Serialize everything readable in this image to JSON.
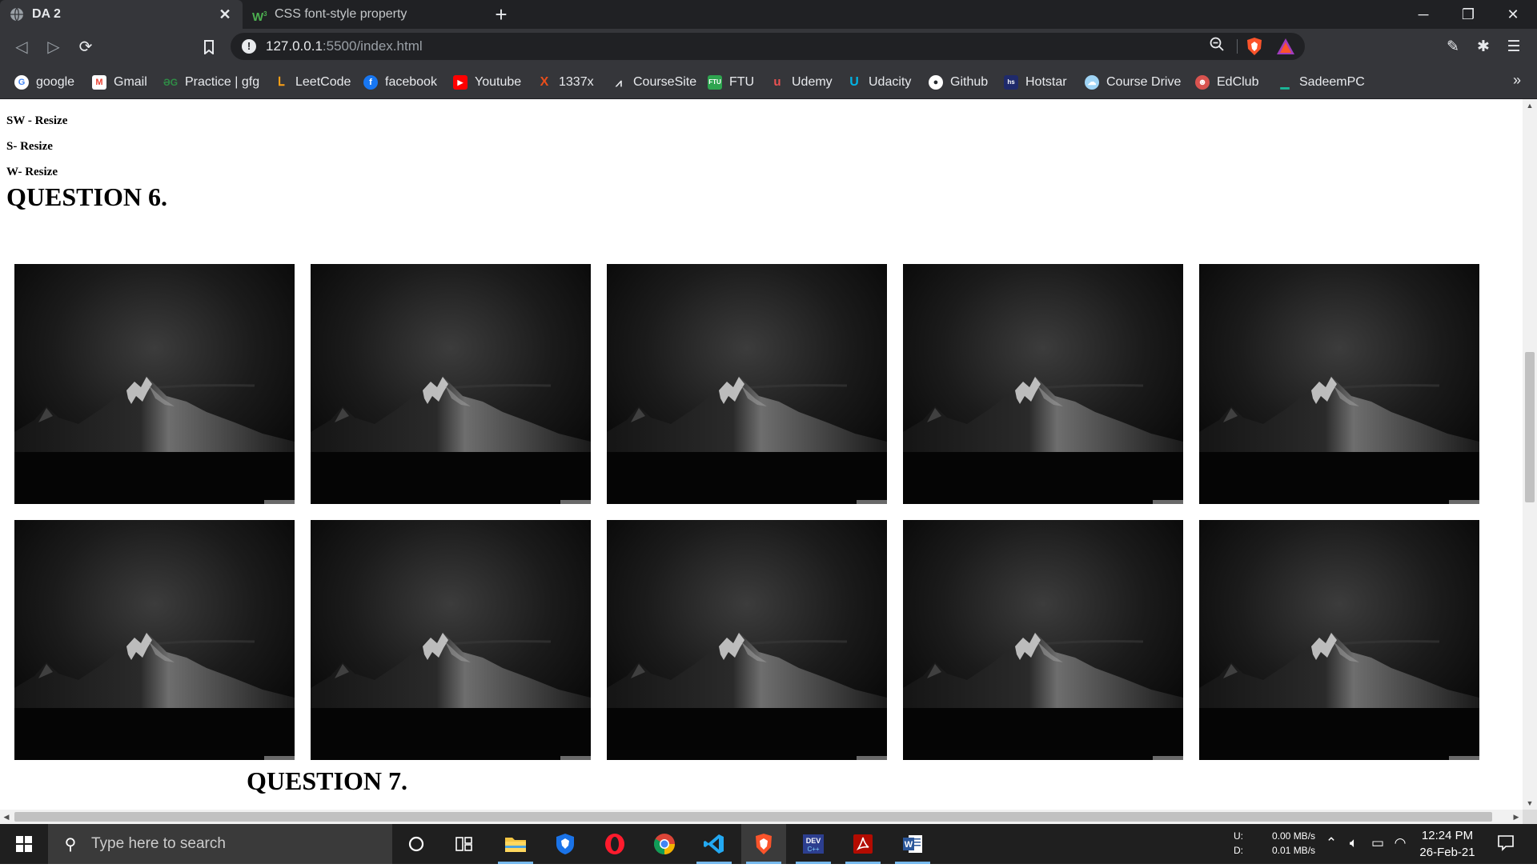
{
  "browser": {
    "tabs": [
      {
        "title": "DA 2",
        "active": true
      },
      {
        "title": "CSS font-style property",
        "active": false
      }
    ],
    "url_host": "127.0.0.1",
    "url_rest": ":5500/index.html",
    "bookmarks": [
      {
        "label": "google",
        "icon": "google-icon",
        "color": "#4285f4"
      },
      {
        "label": "Gmail",
        "icon": "gmail-icon",
        "color": "#ea4335"
      },
      {
        "label": "Practice | gfg",
        "icon": "gfg-icon",
        "color": "#2f8d46"
      },
      {
        "label": "LeetCode",
        "icon": "leetcode-icon",
        "color": "#ffa116"
      },
      {
        "label": "facebook",
        "icon": "facebook-icon",
        "color": "#1877f2"
      },
      {
        "label": "Youtube",
        "icon": "youtube-icon",
        "color": "#ff0000"
      },
      {
        "label": "1337x",
        "icon": "1337x-icon",
        "color": "#e94e1b"
      },
      {
        "label": "CourseSite",
        "icon": "coursesite-icon",
        "color": "#e8eaed"
      },
      {
        "label": "FTU",
        "icon": "ftu-icon",
        "color": "#2ea44f"
      },
      {
        "label": "Udemy",
        "icon": "udemy-icon",
        "color": "#ec5252"
      },
      {
        "label": "Udacity",
        "icon": "udacity-icon",
        "color": "#02b3e4"
      },
      {
        "label": "Github",
        "icon": "github-icon",
        "color": "#ffffff"
      },
      {
        "label": "Hotstar",
        "icon": "hotstar-icon",
        "color": "#1f2a6b"
      },
      {
        "label": "Course Drive",
        "icon": "coursedrive-icon",
        "color": "#9fd4f5"
      },
      {
        "label": "EdClub",
        "icon": "edclub-icon",
        "color": "#d9534f"
      },
      {
        "label": "SadeemPC",
        "icon": "sadeempc-icon",
        "color": "#1abc9c"
      }
    ]
  },
  "page": {
    "resize_lines": [
      "SW - Resize",
      "S- Resize",
      "W- Resize"
    ],
    "question6": "QUESTION 6.",
    "question7": "QUESTION 7.",
    "image_count": 10
  },
  "taskbar": {
    "search_placeholder": "Type here to search",
    "net_up_label": "U:",
    "net_down_label": "D:",
    "net_up": "0.00 MB/s",
    "net_down": "0.01 MB/s",
    "time": "12:24 PM",
    "date": "26-Feb-21"
  }
}
